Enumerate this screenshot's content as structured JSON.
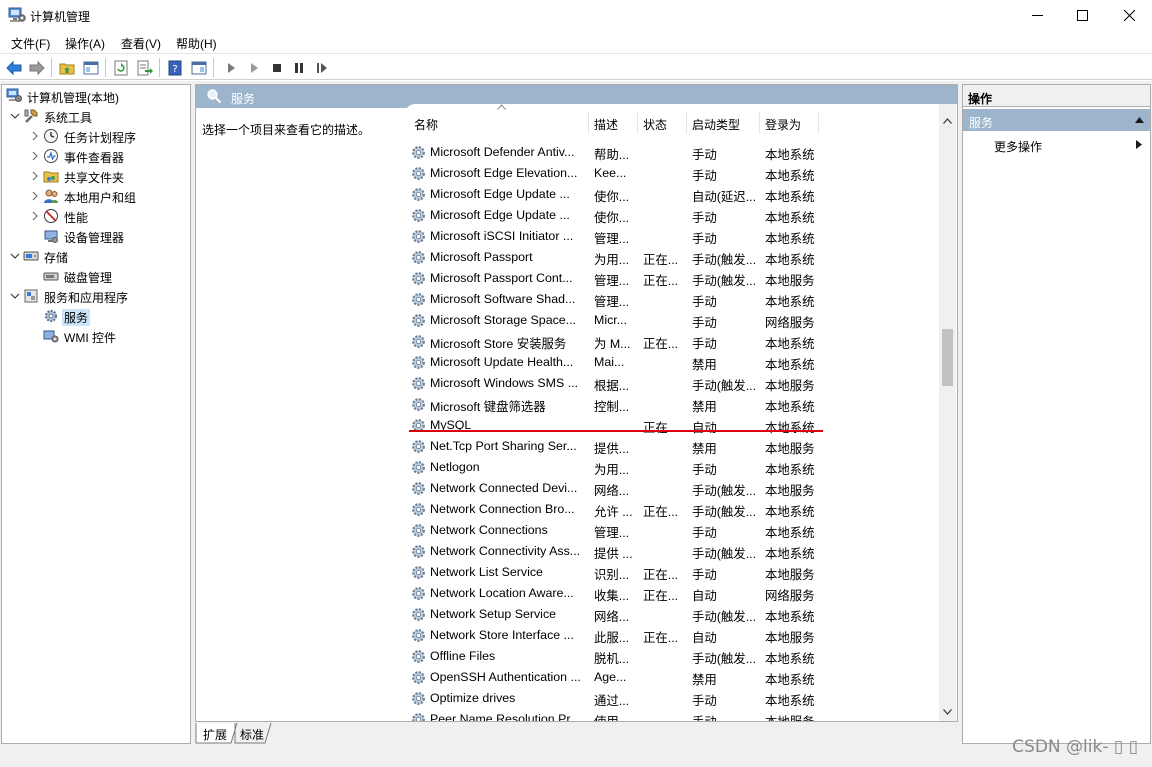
{
  "window": {
    "title": "计算机管理"
  },
  "menu": [
    "文件(F)",
    "操作(A)",
    "查看(V)",
    "帮助(H)"
  ],
  "tree": [
    {
      "label": "计算机管理(本地)",
      "icon": "computer-management-icon",
      "level": 0,
      "expander": "none"
    },
    {
      "label": "系统工具",
      "icon": "system-tools-icon",
      "level": 1,
      "expander": "open"
    },
    {
      "label": "任务计划程序",
      "icon": "task-scheduler-icon",
      "level": 2,
      "expander": "closed"
    },
    {
      "label": "事件查看器",
      "icon": "event-viewer-icon",
      "level": 2,
      "expander": "closed"
    },
    {
      "label": "共享文件夹",
      "icon": "shared-folders-icon",
      "level": 2,
      "expander": "closed"
    },
    {
      "label": "本地用户和组",
      "icon": "local-users-icon",
      "level": 2,
      "expander": "closed"
    },
    {
      "label": "性能",
      "icon": "performance-icon",
      "level": 2,
      "expander": "closed"
    },
    {
      "label": "设备管理器",
      "icon": "device-manager-icon",
      "level": 2,
      "expander": "none"
    },
    {
      "label": "存储",
      "icon": "storage-icon",
      "level": 1,
      "expander": "open"
    },
    {
      "label": "磁盘管理",
      "icon": "disk-management-icon",
      "level": 2,
      "expander": "none"
    },
    {
      "label": "服务和应用程序",
      "icon": "services-apps-icon",
      "level": 1,
      "expander": "open"
    },
    {
      "label": "服务",
      "icon": "services-gear-icon",
      "level": 2,
      "expander": "none",
      "selected": true
    },
    {
      "label": "WMI 控件",
      "icon": "wmi-control-icon",
      "level": 2,
      "expander": "none"
    }
  ],
  "center": {
    "header": "服务",
    "description": "选择一个项目来查看它的描述。",
    "columns": [
      "名称",
      "描述",
      "状态",
      "启动类型",
      "登录为"
    ],
    "rows": [
      [
        "Microsoft Defender Antiv...",
        "帮助...",
        "",
        "手动",
        "本地系统"
      ],
      [
        "Microsoft Edge Elevation...",
        "Kee...",
        "",
        "手动",
        "本地系统"
      ],
      [
        "Microsoft Edge Update ...",
        "使你...",
        "",
        "自动(延迟...",
        "本地系统"
      ],
      [
        "Microsoft Edge Update ...",
        "使你...",
        "",
        "手动",
        "本地系统"
      ],
      [
        "Microsoft iSCSI Initiator ...",
        "管理...",
        "",
        "手动",
        "本地系统"
      ],
      [
        "Microsoft Passport",
        "为用...",
        "正在...",
        "手动(触发...",
        "本地系统"
      ],
      [
        "Microsoft Passport Cont...",
        "管理...",
        "正在...",
        "手动(触发...",
        "本地服务"
      ],
      [
        "Microsoft Software Shad...",
        "管理...",
        "",
        "手动",
        "本地系统"
      ],
      [
        "Microsoft Storage Space...",
        "Micr...",
        "",
        "手动",
        "网络服务"
      ],
      [
        "Microsoft Store 安装服务",
        "为 M...",
        "正在...",
        "手动",
        "本地系统"
      ],
      [
        "Microsoft Update Health...",
        "Mai...",
        "",
        "禁用",
        "本地系统"
      ],
      [
        "Microsoft Windows SMS ...",
        "根据...",
        "",
        "手动(触发...",
        "本地服务"
      ],
      [
        "Microsoft 键盘筛选器",
        "控制...",
        "",
        "禁用",
        "本地系统"
      ],
      [
        "MySQL",
        "",
        "正在...",
        "自动",
        "本地系统"
      ],
      [
        "Net.Tcp Port Sharing Ser...",
        "提供...",
        "",
        "禁用",
        "本地服务"
      ],
      [
        "Netlogon",
        "为用...",
        "",
        "手动",
        "本地系统"
      ],
      [
        "Network Connected Devi...",
        "网络...",
        "",
        "手动(触发...",
        "本地服务"
      ],
      [
        "Network Connection Bro...",
        "允许 ...",
        "正在...",
        "手动(触发...",
        "本地系统"
      ],
      [
        "Network Connections",
        "管理...",
        "",
        "手动",
        "本地系统"
      ],
      [
        "Network Connectivity Ass...",
        "提供 ...",
        "",
        "手动(触发...",
        "本地系统"
      ],
      [
        "Network List Service",
        "识别...",
        "正在...",
        "手动",
        "本地服务"
      ],
      [
        "Network Location Aware...",
        "收集...",
        "正在...",
        "自动",
        "网络服务"
      ],
      [
        "Network Setup Service",
        "网络...",
        "",
        "手动(触发...",
        "本地系统"
      ],
      [
        "Network Store Interface ...",
        "此服...",
        "正在...",
        "自动",
        "本地服务"
      ],
      [
        "Offline Files",
        "脱机...",
        "",
        "手动(触发...",
        "本地系统"
      ],
      [
        "OpenSSH Authentication ...",
        "Age...",
        "",
        "禁用",
        "本地系统"
      ],
      [
        "Optimize drives",
        "通过...",
        "",
        "手动",
        "本地系统"
      ],
      [
        "Peer Name Resolution Pr...",
        "使用...",
        "",
        "手动",
        "本地服务"
      ]
    ],
    "tabs": [
      "扩展",
      "标准"
    ]
  },
  "actions": {
    "title": "操作",
    "section": "服务",
    "more": "更多操作"
  },
  "watermark": "CSDN @lik-",
  "colors": {
    "header_blue": "#9cb4cc",
    "highlight_red": "#d9000c",
    "selection": "#cce4f7"
  }
}
